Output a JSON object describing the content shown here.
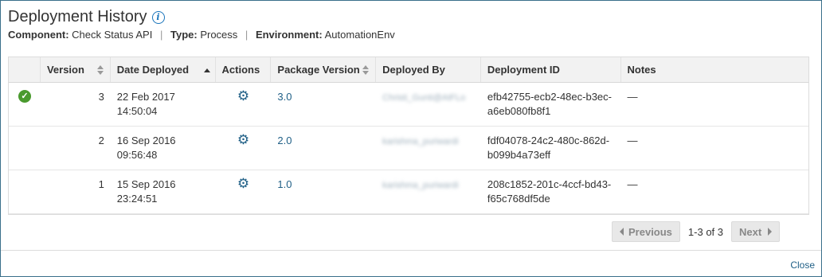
{
  "dialog": {
    "title": "Deployment History",
    "info_icon": "info-icon",
    "meta": {
      "component_label": "Component:",
      "component_value": "Check Status API",
      "type_label": "Type:",
      "type_value": "Process",
      "environment_label": "Environment:",
      "environment_value": "AutomationEnv",
      "separator": "|"
    }
  },
  "table": {
    "columns": [
      "",
      "Version",
      "Date Deployed",
      "Actions",
      "Package Version",
      "Deployed By",
      "Deployment ID",
      "Notes"
    ],
    "rows": [
      {
        "status_icon": "check-circle-icon",
        "version": "3",
        "date_line1": "22 Feb 2017",
        "date_line2": "14:50:04",
        "action_icon": "gear-icon",
        "package_version": "3.0",
        "deployed_by": "Christi_Gunti@AtFLo",
        "deployment_id_line1": "efb42755-ecb2-48ec-b3ec-",
        "deployment_id_line2": "a6eb080fb8f1",
        "notes": "—"
      },
      {
        "status_icon": "",
        "version": "2",
        "date_line1": "16 Sep 2016",
        "date_line2": "09:56:48",
        "action_icon": "gear-icon",
        "package_version": "2.0",
        "deployed_by": "karishma_puriwardi",
        "deployment_id_line1": "fdf04078-24c2-480c-862d-",
        "deployment_id_line2": "b099b4a73eff",
        "notes": "—"
      },
      {
        "status_icon": "",
        "version": "1",
        "date_line1": "15 Sep 2016",
        "date_line2": "23:24:51",
        "action_icon": "gear-icon",
        "package_version": "1.0",
        "deployed_by": "karishma_puriwardi",
        "deployment_id_line1": "208c1852-201c-4ccf-bd43-",
        "deployment_id_line2": "f65c768df5de",
        "notes": "—"
      }
    ]
  },
  "pager": {
    "previous_label": "Previous",
    "count_text": "1-3 of 3",
    "next_label": "Next"
  },
  "footer": {
    "close_label": "Close"
  },
  "colors": {
    "border": "#3a6f8a",
    "link": "#1f5f86",
    "success": "#4a9a2e",
    "header_bg": "#f2f2f2"
  }
}
